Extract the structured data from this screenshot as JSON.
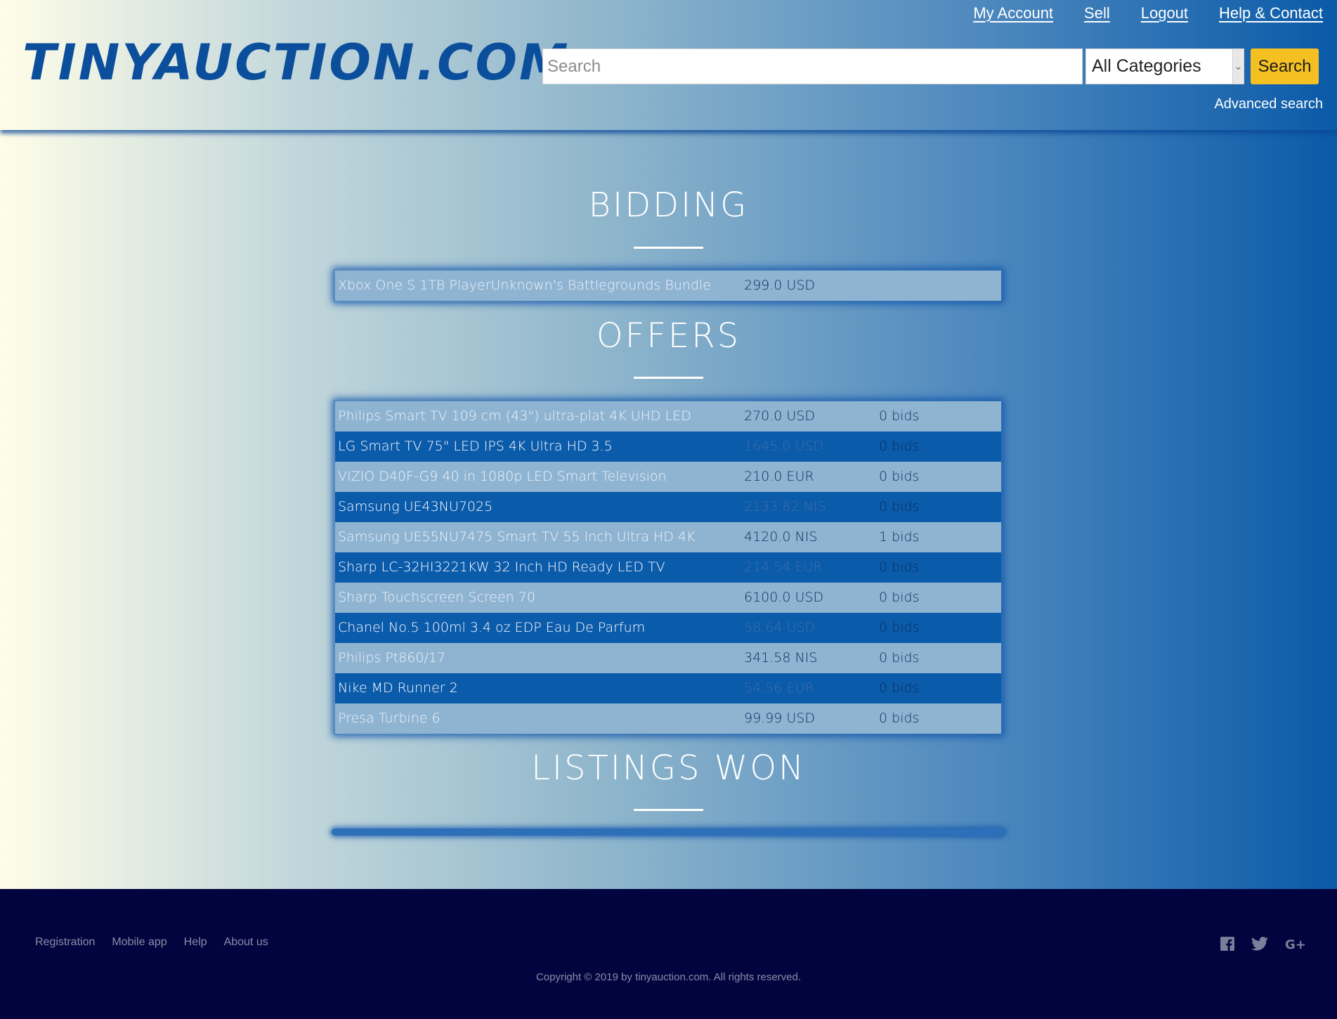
{
  "header": {
    "logo": "TINYAUCTION.COM",
    "nav": [
      "My Account",
      "Sell",
      "Logout",
      "Help & Contact"
    ],
    "search_placeholder": "Search",
    "category": "All Categories",
    "search_button": "Search",
    "advanced_search": "Advanced search"
  },
  "sections": {
    "bidding": "BIDDING",
    "offers": "OFFERS",
    "won": "LISTINGS WON"
  },
  "bidding": [
    {
      "name": "Xbox One S 1TB PlayerUnknown's Battlegrounds Bundle",
      "price": "299.0 USD"
    }
  ],
  "offers": [
    {
      "name": "Philips Smart TV 109 cm (43\") ultra-plat 4K UHD LED",
      "price": "270.0 USD",
      "bids": "0 bids"
    },
    {
      "name": "LG Smart TV 75\" LED IPS 4K Ultra HD 3.5",
      "price": "1645.0 USD",
      "bids": "0 bids"
    },
    {
      "name": "VIZIO D40F-G9 40 in 1080p LED Smart Television",
      "price": "210.0 EUR",
      "bids": "0 bids"
    },
    {
      "name": "Samsung UE43NU7025",
      "price": "2133.82 NIS",
      "bids": "0 bids"
    },
    {
      "name": "Samsung UE55NU7475 Smart TV 55 Inch Ultra HD 4K",
      "price": "4120.0 NIS",
      "bids": "1 bids"
    },
    {
      "name": "Sharp LC-32HI3221KW 32 Inch HD Ready LED TV",
      "price": "214.54 EUR",
      "bids": "0 bids"
    },
    {
      "name": "Sharp Touchscreen Screen 70",
      "price": "6100.0 USD",
      "bids": "0 bids"
    },
    {
      "name": "Chanel No.5 100ml 3.4 oz EDP Eau De Parfum",
      "price": "58.64 USD",
      "bids": "0 bids"
    },
    {
      "name": "Philips Pt860/17",
      "price": "341.58 NIS",
      "bids": "0 bids"
    },
    {
      "name": "Nike MD Runner 2",
      "price": "54.56 EUR",
      "bids": "0 bids"
    },
    {
      "name": "Presa Turbine 6",
      "price": "99.99 USD",
      "bids": "0 bids"
    }
  ],
  "footer": {
    "links": [
      "Registration",
      "Mobile app",
      "Help",
      "About us"
    ],
    "copyright": "Copyright © 2019 by tinyauction.com. All rights reserved.",
    "social_icons": [
      "facebook-icon",
      "twitter-icon",
      "google-plus-icon"
    ]
  }
}
